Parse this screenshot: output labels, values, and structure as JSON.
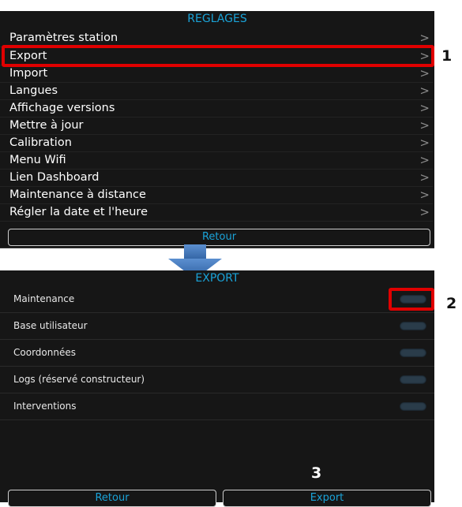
{
  "settings": {
    "title": "REGLAGES",
    "items": [
      {
        "label": "Paramètres station"
      },
      {
        "label": "Export"
      },
      {
        "label": "Import"
      },
      {
        "label": "Langues"
      },
      {
        "label": "Affichage versions"
      },
      {
        "label": "Mettre à jour"
      },
      {
        "label": "Calibration"
      },
      {
        "label": "Menu Wifi"
      },
      {
        "label": "Lien Dashboard"
      },
      {
        "label": "Maintenance à distance"
      },
      {
        "label": "Régler la date et l'heure"
      }
    ],
    "chevron": ">",
    "back_label": "Retour"
  },
  "export": {
    "title": "EXPORT",
    "rows": [
      {
        "label": "Maintenance",
        "toggle": "off"
      },
      {
        "label": "Base utilisateur",
        "toggle": "off"
      },
      {
        "label": "Coordonnées",
        "toggle": "off"
      },
      {
        "label": "Logs (réservé constructeur)",
        "toggle": "off"
      },
      {
        "label": "Interventions",
        "toggle": "off"
      }
    ],
    "back_label": "Retour",
    "export_label": "Export"
  },
  "annotations": {
    "step1": "1",
    "step2": "2",
    "step3": "3",
    "highlight_color": "#e00000"
  },
  "colors": {
    "accent": "#1aa3d8",
    "panel_bg": "#161616",
    "arrow": "#3b6fb0"
  },
  "icons": {
    "chevron": "chevron-right-icon",
    "arrow": "arrow-down-icon"
  }
}
